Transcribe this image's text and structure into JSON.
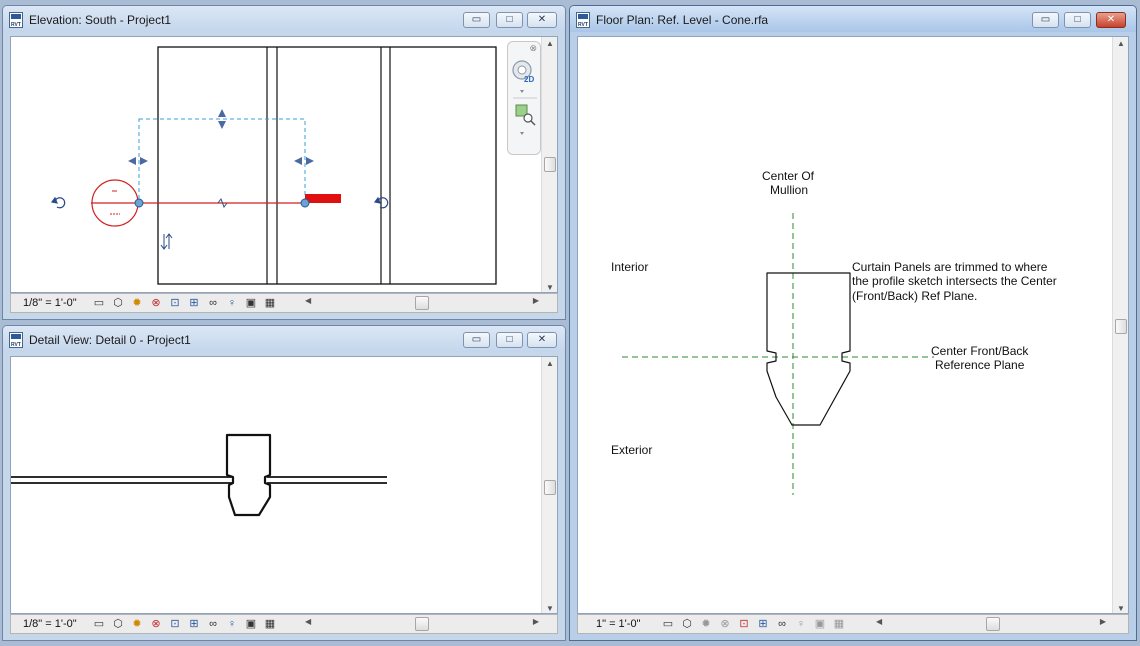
{
  "windows": {
    "elevation": {
      "title": "Elevation: South - Project1",
      "scale": "1/8\" = 1'-0\""
    },
    "detail": {
      "title": "Detail View: Detail 0 - Project1",
      "scale": "1/8\" = 1'-0\""
    },
    "floorplan": {
      "title": "Floor Plan: Ref. Level - Cone.rfa",
      "scale": "1\" = 1'-0\"",
      "labels": {
        "center_mullion_1": "Center Of",
        "center_mullion_2": "Mullion",
        "interior": "Interior",
        "exterior": "Exterior",
        "note_1": "Curtain Panels are trimmed to where",
        "note_2": "the profile sketch intersects the Center",
        "note_3": "(Front/Back) Ref Plane.",
        "refplane_1": "Center Front/Back",
        "refplane_2": "Reference Plane"
      }
    }
  },
  "controls": {
    "minimize": "▭",
    "maximize": "□",
    "close": "✕"
  },
  "navbar": {
    "close": "⊗",
    "wheel_badge": "2D"
  },
  "statusbar_icons": [
    "model-graphics-icon",
    "visual-style-icon",
    "sun-path-icon",
    "shadows-icon",
    "crop-icon",
    "show-crop-icon",
    "temporary-hide-icon",
    "reveal-hidden-icon",
    "lightbulb-icon",
    "worksharing-icon",
    "analysis-display-icon"
  ],
  "colors": {
    "sketch_red": "#d42020",
    "ref_plane_blue": "#3aa0d8",
    "ref_plane_green": "#2f8a2f"
  }
}
